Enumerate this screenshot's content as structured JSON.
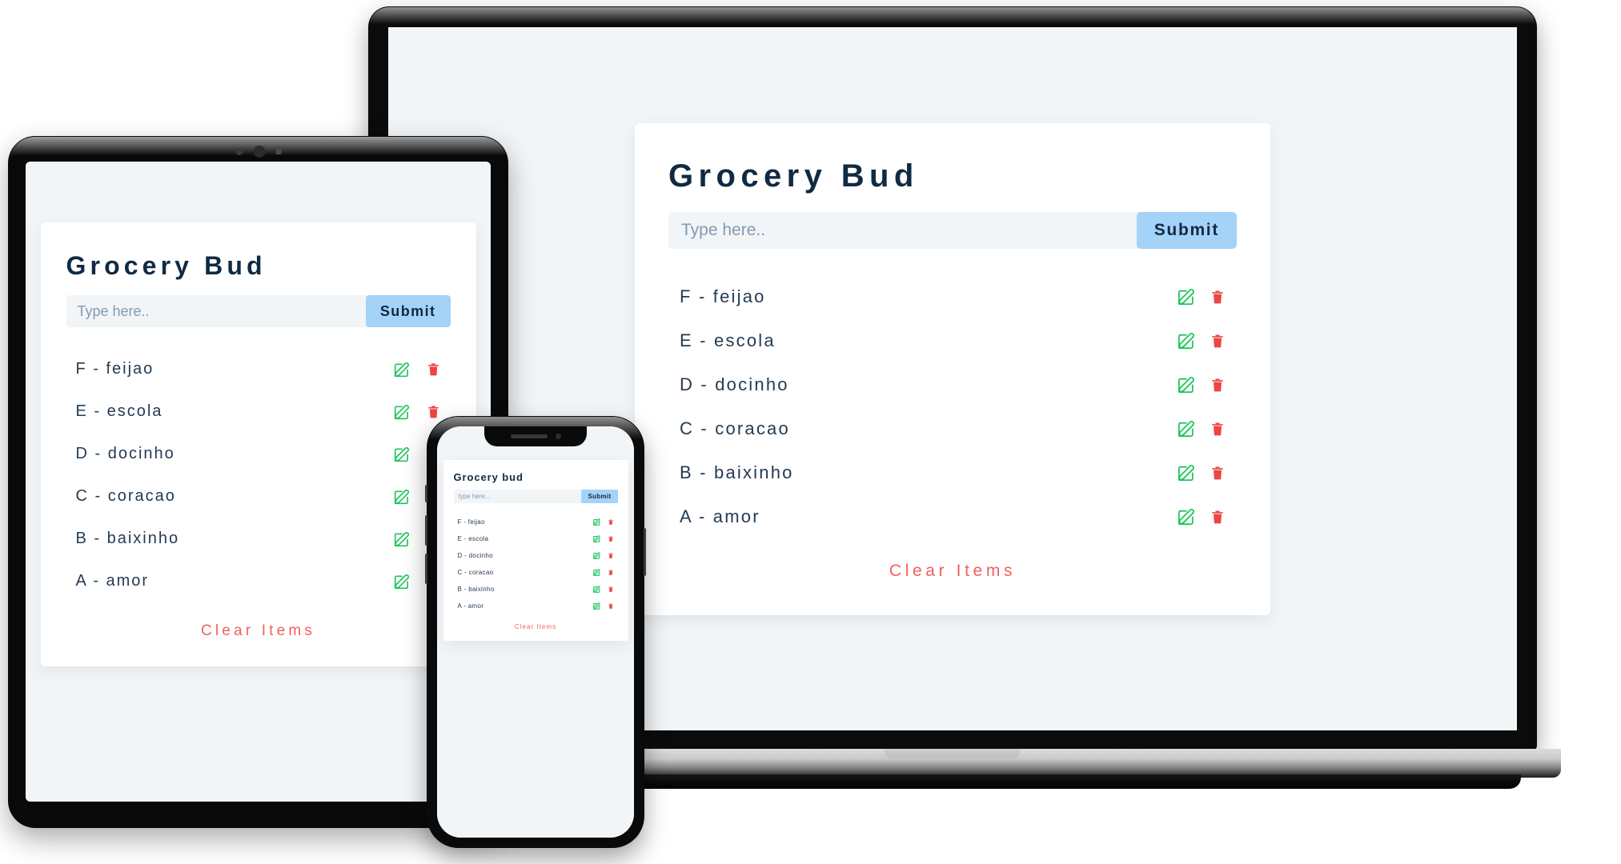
{
  "app": {
    "title_desktop": "Grocery Bud",
    "title_tablet": "Grocery Bud",
    "title_mobile": "Grocery bud",
    "input_placeholder_desktop": "Type here..",
    "input_placeholder_tablet": "Type here..",
    "input_placeholder_mobile": "type here...",
    "input_value": "",
    "submit_label": "Submit",
    "clear_label": "Clear Items",
    "clear_label_mobile": "Clear Items",
    "edit_icon": "edit-square-icon",
    "delete_icon": "trash-icon",
    "items": [
      {
        "text": "F - feijao"
      },
      {
        "text": "E - escola"
      },
      {
        "text": "D - docinho"
      },
      {
        "text": "C - coracao"
      },
      {
        "text": "B - baixinho"
      },
      {
        "text": "A - amor"
      }
    ]
  },
  "colors": {
    "page_background": "#ffffff",
    "screen_background": "#f1f5f8",
    "card_background": "#ffffff",
    "title": "#102a43",
    "item_text": "#243b53",
    "input_background": "#f1f5f8",
    "placeholder": "#829ab1",
    "submit_background": "#a5d2f7",
    "submit_text": "#102a43",
    "edit_icon": "#22c55e",
    "delete_icon": "#ef4444",
    "clear_text": "#f25f5c",
    "device_frame": "#0a0a0b",
    "laptop_base": "#c9c9c9"
  },
  "devices": {
    "laptop_label": "laptop-device",
    "tablet_label": "tablet-device",
    "phone_label": "phone-device"
  }
}
